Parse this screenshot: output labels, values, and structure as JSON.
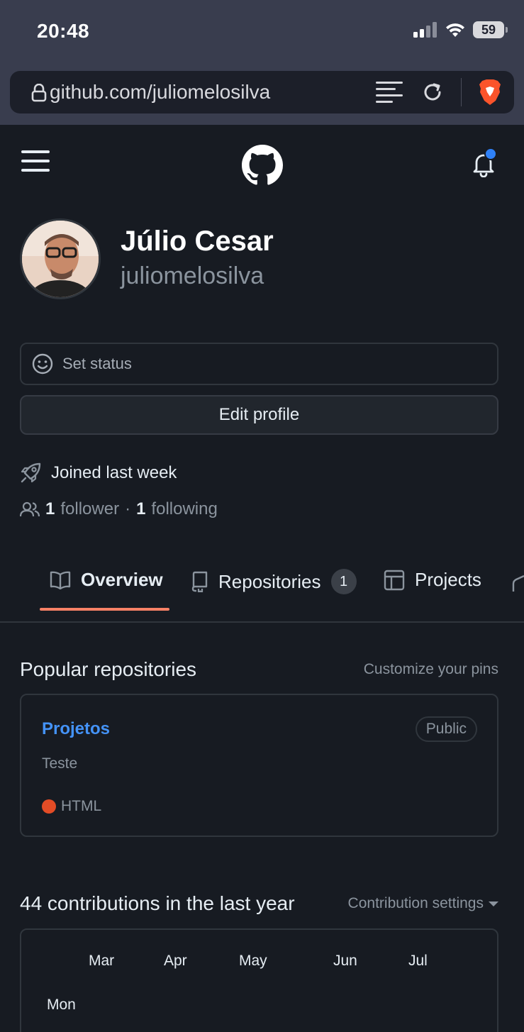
{
  "status_bar": {
    "time": "20:48",
    "battery": "59"
  },
  "browser": {
    "url": "github.com/juliomelosilva"
  },
  "profile": {
    "name": "Júlio Cesar",
    "username": "juliomelosilva",
    "status_label": "Set status",
    "edit_label": "Edit profile",
    "joined": "Joined last week",
    "followers_count": "1",
    "followers_label": "follower",
    "separator": "·",
    "following_count": "1",
    "following_label": "following"
  },
  "tabs": [
    {
      "label": "Overview",
      "icon": "book-icon",
      "active": true
    },
    {
      "label": "Repositories",
      "icon": "repo-icon",
      "count": "1"
    },
    {
      "label": "Projects",
      "icon": "table-icon"
    }
  ],
  "popular": {
    "title": "Popular repositories",
    "customize": "Customize your pins",
    "repo": {
      "name": "Projetos",
      "visibility": "Public",
      "description": "Teste",
      "language": "HTML",
      "language_color": "#e34c26"
    }
  },
  "contributions": {
    "title": "44 contributions in the last year",
    "settings": "Contribution settings",
    "months": [
      "Mar",
      "Apr",
      "May",
      "Jun",
      "Jul"
    ],
    "first_day": "Mon"
  },
  "colors": {
    "accent": "#f78166",
    "link": "#4493f8",
    "notification": "#2f81f7"
  }
}
